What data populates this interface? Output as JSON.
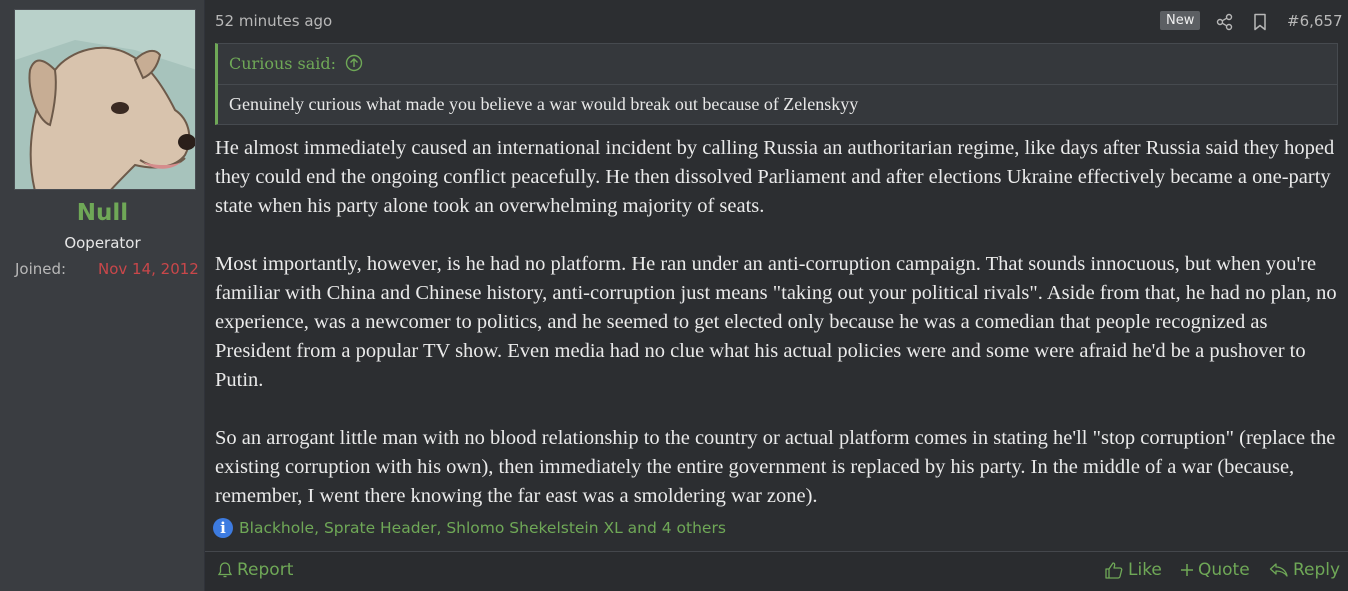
{
  "user": {
    "name": "Null",
    "title": "Ooperator",
    "joined_label": "Joined:",
    "joined_date": "Nov 14, 2012"
  },
  "post": {
    "timestamp": "52 minutes ago",
    "badge": "New",
    "number": "#6,657",
    "quote": {
      "author_line": "Curious said:",
      "text": "Genuinely curious what made you believe a war would break out because of Zelenskyy"
    },
    "paragraphs": [
      "He almost immediately caused an international incident by calling Russia an authoritarian regime, like days after Russia said they hoped they could end the ongoing conflict peacefully. He then dissolved Parliament and after elections Ukraine effectively became a one-party state when his party alone took an overwhelming majority of seats.",
      "Most importantly, however, is he had no platform. He ran under an anti-corruption campaign. That sounds innocuous, but when you're familiar with China and Chinese history, anti-corruption just means \"taking out your political rivals\". Aside from that, he had no plan, no experience, was a newcomer to politics, and he seemed to get elected only because he was a comedian that people recognized as President from a popular TV show. Even media had no clue what his actual policies were and some were afraid he'd be a pushover to Putin.",
      "So an arrogant little man with no blood relationship to the country or actual platform comes in stating he'll \"stop corruption\" (replace the existing corruption with his own), then immediately the entire government is replaced by his party. In the middle of a war (because, remember, I went there knowing the far east was a smoldering war zone)."
    ],
    "reactions": "Blackhole, Sprate Header, Shlomo Shekelstein XL and 4 others"
  },
  "footer": {
    "report": "Report",
    "like": "Like",
    "quote": "Quote",
    "reply": "Reply"
  },
  "colors": {
    "accent": "#6fa857",
    "joined_date": "#c9474a",
    "info": "#3d7be0"
  },
  "icons": [
    "share-icon",
    "bookmark-icon",
    "arrow-up-circle-icon",
    "info-icon",
    "bell-icon",
    "thumbs-up-icon",
    "plus-icon",
    "reply-icon"
  ]
}
